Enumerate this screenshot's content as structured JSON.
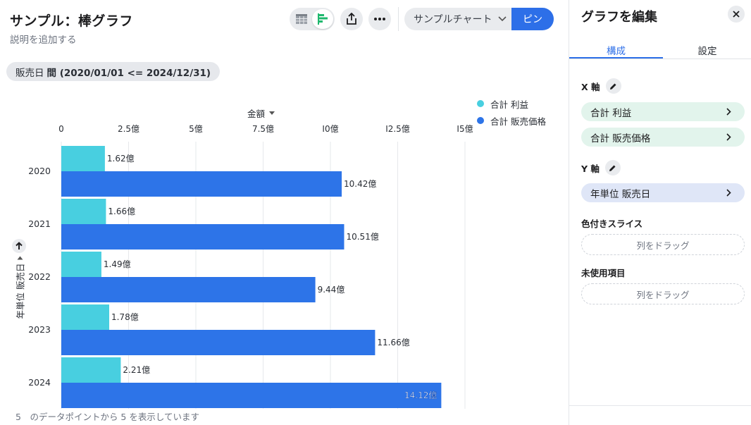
{
  "header": {
    "title": "サンプル：棒グラフ",
    "subtitle": "説明を追加する"
  },
  "toolbar": {
    "table_view_icon": "table-icon",
    "chart_view_icon": "bar-chart-icon",
    "share_icon": "share-icon",
    "more_icon": "more-icon",
    "chart_select_value": "サンプルチャート",
    "pin_label": "ピン"
  },
  "filter": {
    "field": "販売日",
    "condition": "間 (2020/01/01 <= 2024/12/31)"
  },
  "chart_data": {
    "type": "bar",
    "orientation": "horizontal",
    "xlabel": "金額",
    "ylabel": "年単位 販売日",
    "categories": [
      "2020",
      "2021",
      "2022",
      "2023",
      "2024"
    ],
    "series": [
      {
        "name": "合計 利益",
        "color": "#48cfe0",
        "values": [
          1.62,
          1.66,
          1.49,
          1.78,
          2.21
        ],
        "labels": [
          "1.62億",
          "1.66億",
          "1.49億",
          "1.78億",
          "2.21億"
        ]
      },
      {
        "name": "合計 販売価格",
        "color": "#2d74e8",
        "values": [
          10.42,
          10.51,
          9.44,
          11.66,
          14.12
        ],
        "labels": [
          "10.42億",
          "10.51億",
          "9.44億",
          "11.66億",
          "14.12億"
        ]
      }
    ],
    "xlim": [
      0,
      15
    ],
    "x_ticks": [
      0,
      2.5,
      5,
      7.5,
      10,
      12.5,
      15
    ],
    "x_tick_labels": [
      "0",
      "2.5億",
      "5億",
      "7.5億",
      "I0億",
      "I2.5億",
      "I5億"
    ],
    "grid": true,
    "legend_position": "top-right"
  },
  "footer": {
    "text": "5　のデータポイントから 5 を表示しています"
  },
  "panel": {
    "title": "グラフを編集",
    "tabs": [
      "構成",
      "設定"
    ],
    "x_axis_label": "X 軸",
    "x_axis_items": [
      "合計 利益",
      "合計 販売価格"
    ],
    "y_axis_label": "Y 軸",
    "y_axis_items": [
      "年単位 販売日"
    ],
    "color_slice_label": "色付きスライス",
    "color_slice_placeholder": "列をドラッグ",
    "unused_label": "未使用項目",
    "unused_placeholder": "列をドラッグ"
  }
}
